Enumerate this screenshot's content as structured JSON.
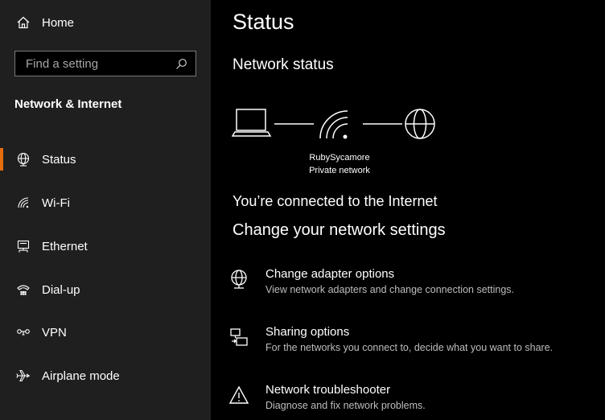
{
  "sidebar": {
    "home_label": "Home",
    "search_placeholder": "Find a setting",
    "section_title": "Network & Internet",
    "items": [
      {
        "label": "Status",
        "icon": "globe-network-icon",
        "active": true
      },
      {
        "label": "Wi-Fi",
        "icon": "wifi-icon"
      },
      {
        "label": "Ethernet",
        "icon": "ethernet-icon"
      },
      {
        "label": "Dial-up",
        "icon": "dial-up-icon"
      },
      {
        "label": "VPN",
        "icon": "vpn-icon"
      },
      {
        "label": "Airplane mode",
        "icon": "airplane-icon"
      }
    ]
  },
  "main": {
    "title": "Status",
    "network_status_heading": "Network status",
    "network_name": "RubySycamore",
    "network_type": "Private network",
    "connection_message": "You’re connected to the Internet",
    "change_heading": "Change your network settings",
    "options": [
      {
        "title": "Change adapter options",
        "desc": "View network adapters and change connection settings.",
        "icon": "adapter-icon"
      },
      {
        "title": "Sharing options",
        "desc": "For the networks you connect to, decide what you want to share.",
        "icon": "sharing-icon"
      },
      {
        "title": "Network troubleshooter",
        "desc": "Diagnose and fix network problems.",
        "icon": "warning-icon"
      }
    ]
  },
  "colors": {
    "accent": "#e46c0a",
    "sidebar_bg": "#1f1f1f",
    "main_bg": "#000000"
  }
}
